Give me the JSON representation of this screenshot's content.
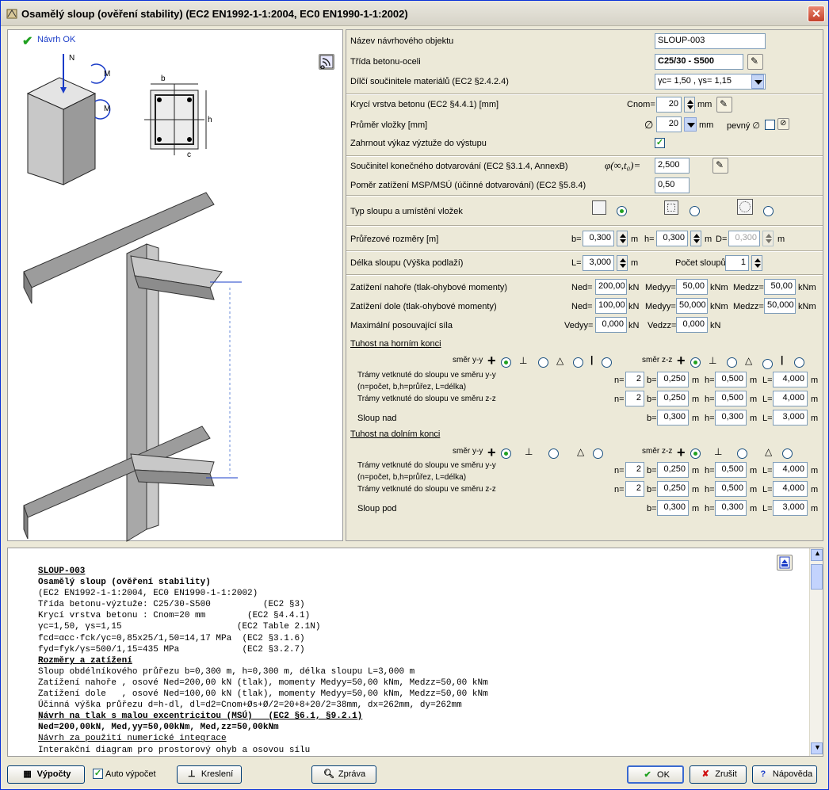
{
  "window": {
    "title": "Osamělý sloup (ověření stability) (EC2 EN1992-1-1:2004, EC0 EN1990-1-1:2002)"
  },
  "left": {
    "status": "Návrh OK",
    "labels": {
      "ned": "N",
      "my": "M",
      "mz": "M",
      "b": "b",
      "h": "h",
      "cnom": "c"
    }
  },
  "form": {
    "name_label": "Název návrhového objektu",
    "name_value": "SLOUP-003",
    "class_label": "Třída betonu-oceli",
    "class_value": "C25/30 - S500",
    "factors_label": "Dílčí součinitele materiálů (EC2 §2.4.2.4)",
    "factors_value": "γc= 1,50 , γs= 1,15",
    "cover_label": "Krycí vrstva betonu (EC2 §4.4.1) [mm]",
    "cnom_label": "Cnom=",
    "cnom_value": "20",
    "mm": "mm",
    "diam_label": "Průměr vložky [mm]",
    "diam_symbol": "∅",
    "diam_value": "20",
    "fixed_label": "pevný ∅",
    "include_label": "Zahrnout výkaz výztuže do výstupu",
    "creep_label": "Součinitel konečného dotvarování (EC2 §3.1.4, AnnexB)",
    "creep_symbol": "φ(∞,t₀)=",
    "creep_value": "2,500",
    "ratio_label": "Poměr zatížení MSP/MSÚ (účinné dotvarování) (EC2 §5.8.4)",
    "ratio_value": "0,50",
    "type_label": "Typ sloupu a umístění vložek",
    "dims_label": "Průřezové rozměry [m]",
    "b_label": "b=",
    "b_value": "0,300",
    "h_label": "h=",
    "h_value": "0,300",
    "d_label": "D=",
    "d_value": "0,300",
    "m": "m",
    "length_label": "Délka sloupu (Výška podlaží)",
    "l_label": "L=",
    "l_value": "3,000",
    "count_label": "Počet sloupů",
    "count_value": "1",
    "top_load_label": "Zatížení nahoře (tlak-ohybové momenty)",
    "ned_label": "Ned=",
    "top_ned": "200,00",
    "kn": "kN",
    "medyy_label": "Medyy=",
    "top_medyy": "50,00",
    "knm": "kNm",
    "medzz_label": "Medzz=",
    "top_medzz": "50,00",
    "bot_load_label": "Zatížení dole (tlak-ohybové momenty)",
    "bot_ned": "100,00",
    "bot_medyy": "50,000",
    "bot_medzz": "50,000",
    "shear_label": "Maximální posouvající síla",
    "vedyy_label": "Vedyy=",
    "vedyy": "0,000",
    "vedzz_label": "Vedzz=",
    "vedzz": "0,000",
    "top_stiff_label": "Tuhost na horním konci",
    "bot_stiff_label": "Tuhost na dolním konci",
    "dir_y": "směr y-y",
    "dir_z": "směr z-z",
    "beams_y_label": "Trámy vetknuté do sloupu ve směru y-y",
    "beams_note": "(n=počet, b,h=průřez, L=délka)",
    "beams_z_label": "Trámy vetknuté do sloupu ve směru z-z",
    "col_above_label": "Sloup nad",
    "col_below_label": "Sloup pod",
    "n_label": "n=",
    "L_label": "L=",
    "top": {
      "y_n": "2",
      "y_b": "0,250",
      "y_h": "0,500",
      "y_L": "4,000",
      "z_n": "2",
      "z_b": "0,250",
      "z_h": "0,500",
      "z_L": "4,000",
      "c_b": "0,300",
      "c_h": "0,300",
      "c_L": "3,000"
    },
    "bot": {
      "y_n": "2",
      "y_b": "0,250",
      "y_h": "0,500",
      "y_L": "4,000",
      "z_n": "2",
      "z_b": "0,250",
      "z_h": "0,500",
      "z_L": "4,000",
      "c_b": "0,300",
      "c_h": "0,300",
      "c_L": "3,000"
    }
  },
  "report": {
    "l1": "SLOUP-003",
    "l2": "Osamělý sloup (ověření stability)",
    "l3": "(EC2 EN1992-1-1:2004, EC0 EN1990-1-1:2002)",
    "l4": "Třída betonu-výztuže: C25/30-S500          (EC2 §3)",
    "l5": "Krycí vrstva betonu : Cnom=20 mm        (EC2 §4.4.1)",
    "l6": "γc=1,50, γs=1,15                      (EC2 Table 2.1N)",
    "l7": "fcd=αcc·fck/γc=0,85x25/1,50=14,17 MPa  (EC2 §3.1.6)",
    "l8": "fyd=fyk/γs=500/1,15=435 MPa            (EC2 §3.2.7)",
    "l9": "Rozměry a zatížení",
    "l10": "Sloup obdélníkového průřezu b=0,300 m, h=0,300 m, délka sloupu L=3,000 m",
    "l11": "Zatížení nahoře , osové Ned=200,00 kN (tlak), momenty Medyy=50,00 kNm, Medzz=50,00 kNm",
    "l12": "Zatížení dole   , osové Ned=100,00 kN (tlak), momenty Medyy=50,00 kNm, Medzz=50,00 kNm",
    "l13": "Účinná výška průřezu d=h-dl, dl=d2=Cnom+Øs+Ø/2=20+8+20/2=38mm, dx=262mm, dy=262mm",
    "l14": "Návrh na tlak s malou excentricitou (MSÚ)   (EC2 §6.1, §9.2.1)",
    "l15": "Ned=200,00kN, Med,yy=50,00kNm, Med,zz=50,00kNm",
    "l16": "Návrh za použití numerické integrace",
    "l17": "Interakční diagram pro prostorový ohyb a osovou sílu"
  },
  "buttons": {
    "calc": "Výpočty",
    "auto": "Auto výpočet",
    "draw": "Kreslení",
    "report": "Zpráva",
    "ok": "OK",
    "cancel": "Zrušit",
    "help": "Nápověda"
  }
}
